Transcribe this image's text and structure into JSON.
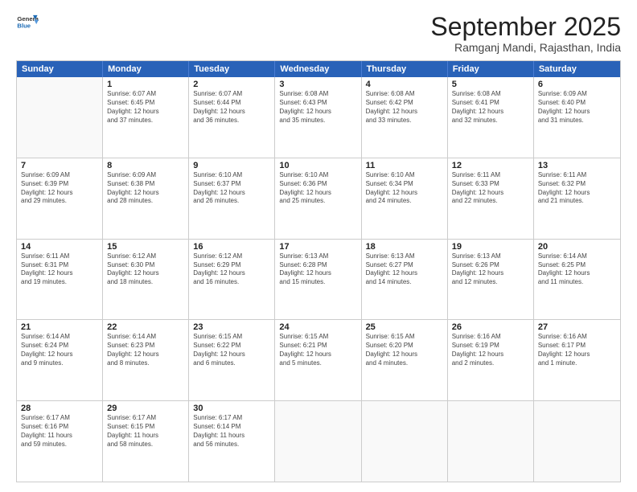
{
  "logo": {
    "line1": "General",
    "line2": "Blue"
  },
  "title": "September 2025",
  "location": "Ramganj Mandi, Rajasthan, India",
  "weekdays": [
    "Sunday",
    "Monday",
    "Tuesday",
    "Wednesday",
    "Thursday",
    "Friday",
    "Saturday"
  ],
  "weeks": [
    [
      {
        "day": "",
        "lines": []
      },
      {
        "day": "1",
        "lines": [
          "Sunrise: 6:07 AM",
          "Sunset: 6:45 PM",
          "Daylight: 12 hours",
          "and 37 minutes."
        ]
      },
      {
        "day": "2",
        "lines": [
          "Sunrise: 6:07 AM",
          "Sunset: 6:44 PM",
          "Daylight: 12 hours",
          "and 36 minutes."
        ]
      },
      {
        "day": "3",
        "lines": [
          "Sunrise: 6:08 AM",
          "Sunset: 6:43 PM",
          "Daylight: 12 hours",
          "and 35 minutes."
        ]
      },
      {
        "day": "4",
        "lines": [
          "Sunrise: 6:08 AM",
          "Sunset: 6:42 PM",
          "Daylight: 12 hours",
          "and 33 minutes."
        ]
      },
      {
        "day": "5",
        "lines": [
          "Sunrise: 6:08 AM",
          "Sunset: 6:41 PM",
          "Daylight: 12 hours",
          "and 32 minutes."
        ]
      },
      {
        "day": "6",
        "lines": [
          "Sunrise: 6:09 AM",
          "Sunset: 6:40 PM",
          "Daylight: 12 hours",
          "and 31 minutes."
        ]
      }
    ],
    [
      {
        "day": "7",
        "lines": [
          "Sunrise: 6:09 AM",
          "Sunset: 6:39 PM",
          "Daylight: 12 hours",
          "and 29 minutes."
        ]
      },
      {
        "day": "8",
        "lines": [
          "Sunrise: 6:09 AM",
          "Sunset: 6:38 PM",
          "Daylight: 12 hours",
          "and 28 minutes."
        ]
      },
      {
        "day": "9",
        "lines": [
          "Sunrise: 6:10 AM",
          "Sunset: 6:37 PM",
          "Daylight: 12 hours",
          "and 26 minutes."
        ]
      },
      {
        "day": "10",
        "lines": [
          "Sunrise: 6:10 AM",
          "Sunset: 6:36 PM",
          "Daylight: 12 hours",
          "and 25 minutes."
        ]
      },
      {
        "day": "11",
        "lines": [
          "Sunrise: 6:10 AM",
          "Sunset: 6:34 PM",
          "Daylight: 12 hours",
          "and 24 minutes."
        ]
      },
      {
        "day": "12",
        "lines": [
          "Sunrise: 6:11 AM",
          "Sunset: 6:33 PM",
          "Daylight: 12 hours",
          "and 22 minutes."
        ]
      },
      {
        "day": "13",
        "lines": [
          "Sunrise: 6:11 AM",
          "Sunset: 6:32 PM",
          "Daylight: 12 hours",
          "and 21 minutes."
        ]
      }
    ],
    [
      {
        "day": "14",
        "lines": [
          "Sunrise: 6:11 AM",
          "Sunset: 6:31 PM",
          "Daylight: 12 hours",
          "and 19 minutes."
        ]
      },
      {
        "day": "15",
        "lines": [
          "Sunrise: 6:12 AM",
          "Sunset: 6:30 PM",
          "Daylight: 12 hours",
          "and 18 minutes."
        ]
      },
      {
        "day": "16",
        "lines": [
          "Sunrise: 6:12 AM",
          "Sunset: 6:29 PM",
          "Daylight: 12 hours",
          "and 16 minutes."
        ]
      },
      {
        "day": "17",
        "lines": [
          "Sunrise: 6:13 AM",
          "Sunset: 6:28 PM",
          "Daylight: 12 hours",
          "and 15 minutes."
        ]
      },
      {
        "day": "18",
        "lines": [
          "Sunrise: 6:13 AM",
          "Sunset: 6:27 PM",
          "Daylight: 12 hours",
          "and 14 minutes."
        ]
      },
      {
        "day": "19",
        "lines": [
          "Sunrise: 6:13 AM",
          "Sunset: 6:26 PM",
          "Daylight: 12 hours",
          "and 12 minutes."
        ]
      },
      {
        "day": "20",
        "lines": [
          "Sunrise: 6:14 AM",
          "Sunset: 6:25 PM",
          "Daylight: 12 hours",
          "and 11 minutes."
        ]
      }
    ],
    [
      {
        "day": "21",
        "lines": [
          "Sunrise: 6:14 AM",
          "Sunset: 6:24 PM",
          "Daylight: 12 hours",
          "and 9 minutes."
        ]
      },
      {
        "day": "22",
        "lines": [
          "Sunrise: 6:14 AM",
          "Sunset: 6:23 PM",
          "Daylight: 12 hours",
          "and 8 minutes."
        ]
      },
      {
        "day": "23",
        "lines": [
          "Sunrise: 6:15 AM",
          "Sunset: 6:22 PM",
          "Daylight: 12 hours",
          "and 6 minutes."
        ]
      },
      {
        "day": "24",
        "lines": [
          "Sunrise: 6:15 AM",
          "Sunset: 6:21 PM",
          "Daylight: 12 hours",
          "and 5 minutes."
        ]
      },
      {
        "day": "25",
        "lines": [
          "Sunrise: 6:15 AM",
          "Sunset: 6:20 PM",
          "Daylight: 12 hours",
          "and 4 minutes."
        ]
      },
      {
        "day": "26",
        "lines": [
          "Sunrise: 6:16 AM",
          "Sunset: 6:19 PM",
          "Daylight: 12 hours",
          "and 2 minutes."
        ]
      },
      {
        "day": "27",
        "lines": [
          "Sunrise: 6:16 AM",
          "Sunset: 6:17 PM",
          "Daylight: 12 hours",
          "and 1 minute."
        ]
      }
    ],
    [
      {
        "day": "28",
        "lines": [
          "Sunrise: 6:17 AM",
          "Sunset: 6:16 PM",
          "Daylight: 11 hours",
          "and 59 minutes."
        ]
      },
      {
        "day": "29",
        "lines": [
          "Sunrise: 6:17 AM",
          "Sunset: 6:15 PM",
          "Daylight: 11 hours",
          "and 58 minutes."
        ]
      },
      {
        "day": "30",
        "lines": [
          "Sunrise: 6:17 AM",
          "Sunset: 6:14 PM",
          "Daylight: 11 hours",
          "and 56 minutes."
        ]
      },
      {
        "day": "",
        "lines": []
      },
      {
        "day": "",
        "lines": []
      },
      {
        "day": "",
        "lines": []
      },
      {
        "day": "",
        "lines": []
      }
    ]
  ]
}
